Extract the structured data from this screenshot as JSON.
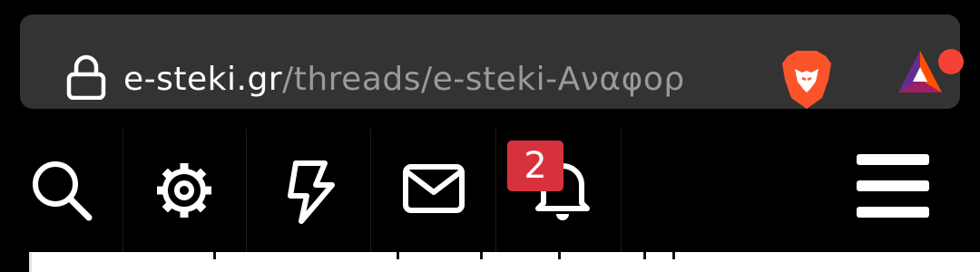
{
  "browser": {
    "url_host": "e-steki.gr",
    "url_path": "/threads/e-steki-Αναφορ",
    "lock_icon": "lock-icon",
    "shield_icon": "brave-lion-icon",
    "rewards_icon": "bat-rewards-icon",
    "colors": {
      "bar": "#333333",
      "host": "#ffffff",
      "path": "#9a9a9a",
      "brave": "#fb542b",
      "bat_dot": "#f44336"
    }
  },
  "nav": {
    "items": [
      {
        "name": "search",
        "icon": "search-icon"
      },
      {
        "name": "settings",
        "icon": "gear-icon"
      },
      {
        "name": "whats-new",
        "icon": "lightning-icon"
      },
      {
        "name": "messages",
        "icon": "envelope-icon"
      },
      {
        "name": "alerts",
        "icon": "bell-icon"
      },
      {
        "name": "menu",
        "icon": "hamburger-icon"
      }
    ],
    "alerts_badge": "2",
    "colors": {
      "icon": "#ffffff",
      "badge": "#d7323c"
    }
  }
}
